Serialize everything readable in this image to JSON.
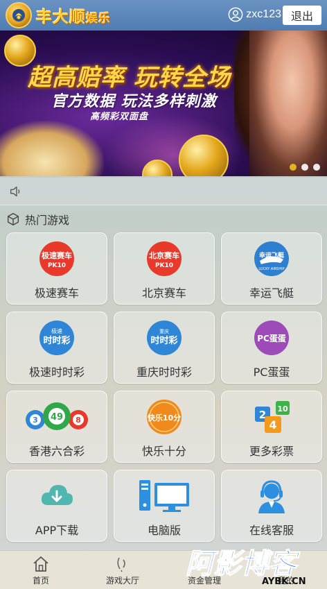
{
  "header": {
    "logo_text": "丰大顺",
    "logo_suffix": "娱乐",
    "username": "zxc123",
    "logout_label": "退出"
  },
  "banner": {
    "title": "超高赔率 玩转全场",
    "subtitle": "官方数据 玩法多样刺激",
    "tagline": "高频彩双面盘",
    "slides": 3,
    "active_slide": 1
  },
  "section": {
    "title": "热门游戏"
  },
  "games": [
    {
      "label": "极速赛车",
      "icon": "pk10-red-icon",
      "badge_text": "极速赛车",
      "badge_sub": "PK10"
    },
    {
      "label": "北京赛车",
      "icon": "pk10-red-icon",
      "badge_text": "北京赛车",
      "badge_sub": "PK10"
    },
    {
      "label": "幸运飞艇",
      "icon": "airship-icon",
      "badge_text": "幸运飞艇",
      "badge_sub": "LUCKY AIRSHIP"
    },
    {
      "label": "极速时时彩",
      "icon": "ssc-blue-icon",
      "badge_text": "时时彩"
    },
    {
      "label": "重庆时时彩",
      "icon": "ssc-blue-icon",
      "badge_text": "时时彩"
    },
    {
      "label": "PC蛋蛋",
      "icon": "pc-egg-icon",
      "badge_text": "PC蛋蛋"
    },
    {
      "label": "香港六合彩",
      "icon": "lottery-balls-icon",
      "balls": [
        "3",
        "49",
        "8"
      ]
    },
    {
      "label": "快乐十分",
      "icon": "happy10-icon",
      "badge_text": "快乐10分"
    },
    {
      "label": "更多彩票",
      "icon": "number-cards-icon",
      "cards": [
        "2",
        "4",
        "10"
      ]
    },
    {
      "label": "APP下载",
      "icon": "cloud-download-icon"
    },
    {
      "label": "电脑版",
      "icon": "desktop-computer-icon"
    },
    {
      "label": "在线客服",
      "icon": "customer-service-icon"
    }
  ],
  "nav": [
    {
      "label": "首页",
      "icon": "home-icon"
    },
    {
      "label": "游戏大厅",
      "icon": "game-hall-icon"
    },
    {
      "label": "资金管理",
      "icon": "wallet-icon"
    },
    {
      "label": "我的",
      "icon": "user-icon"
    }
  ],
  "watermark": {
    "main": "阿影博客",
    "sub": "AYBK.CN"
  },
  "colors": {
    "header_bg": "#5a86bb",
    "logo_gold": "#ffd23a",
    "red_badge": "#e8392a",
    "blue_badge": "#2f86d6",
    "purple_badge": "#9c4bb8",
    "teal_icon": "#4fb6b0",
    "service_blue": "#2d8fe0"
  }
}
